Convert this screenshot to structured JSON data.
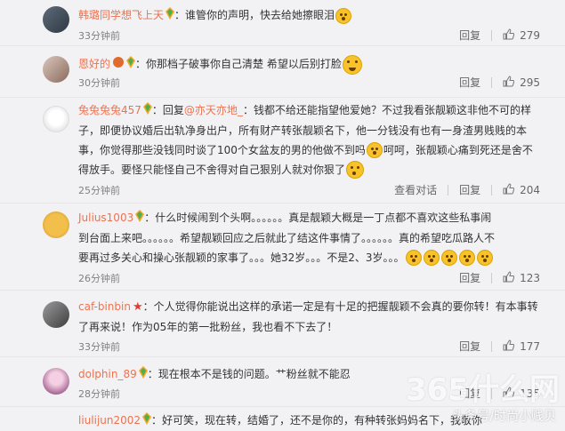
{
  "comments": [
    {
      "name": "韩璐同学想飞上天",
      "lines": [
        "：谁管你的声明，快去给她擦眼泪"
      ],
      "time": "33分钟前",
      "reply": "回复",
      "likes": "279"
    },
    {
      "name": "恩好的",
      "lines": [
        "：你那档子破事你自己清楚 希望以后别打脸"
      ],
      "time": "30分钟前",
      "reply": "回复",
      "likes": "295"
    },
    {
      "name": "兔兔兔兔457",
      "reply_prefix": "：回复",
      "reply_to": "@亦天亦地_",
      "lines": [
        "：钱都不给还能指望他爱她？不过我看张靓颖这非他不可的样",
        "子，即便协议婚后出轨净身出户，所有财产转张靓颖名下，他一分钱没有也有一身渣男贱贱的本",
        "事，你觉得那些没钱同时谈了100个女盆友的男的他做不到吗",
        "呵呵，张靓颖心痛到死还是舍不",
        "得放手。要怪只能怪自己不舍得对自己狠别人就对你狠了"
      ],
      "time": "25分钟前",
      "conversation": "查看对话",
      "reply": "回复",
      "likes": "204"
    },
    {
      "name": "Julius1003",
      "lines": [
        "：什么时候闹到个头啊。。。。。。真是靓颖大概是一丁点都不喜欢这些私事闹",
        "到台面上来吧。。。。。。希望靓颖回应之后就此了结这件事情了。。。。。。真的希望吃瓜路人不",
        "要再过多关心和操心张靓颖的家事了。。。她32岁。。。不是2、3岁。。。"
      ],
      "time": "26分钟前",
      "reply": "回复",
      "likes": "123"
    },
    {
      "name": "caf-binbin",
      "lines": [
        "：个人觉得你能说出这样的承诺一定是有十足的把握靓颖不会真的要你转！有本事转",
        "了再来说！作为05年的第一批粉丝，我也看不下去了！"
      ],
      "time": "33分钟前",
      "reply": "回复",
      "likes": "177"
    },
    {
      "name": "dolphin_89",
      "lines": [
        "：现在根本不是钱的问题。艹粉丝就不能忍"
      ],
      "time": "28分钟前",
      "reply": "回复",
      "likes": "135"
    },
    {
      "name": "liulijun2002",
      "lines": [
        "：好可笑，现在转，结婚了，还不是你的，有种转张妈妈名下，我敬你"
      ],
      "time": "",
      "reply": "",
      "likes": ""
    }
  ],
  "watermark": {
    "site": "365什么网",
    "sub": "头条号/时尚小贱贝"
  },
  "colors": {
    "name": "#eb7350",
    "meta": "#808080",
    "bg": "#f2f2f5"
  },
  "icons": [
    "vip-badge-icon",
    "thumbs-up-icon",
    "crying-emoji-icon",
    "smile-emoji-icon",
    "surprised-emoji-icon",
    "red-star-icon"
  ]
}
